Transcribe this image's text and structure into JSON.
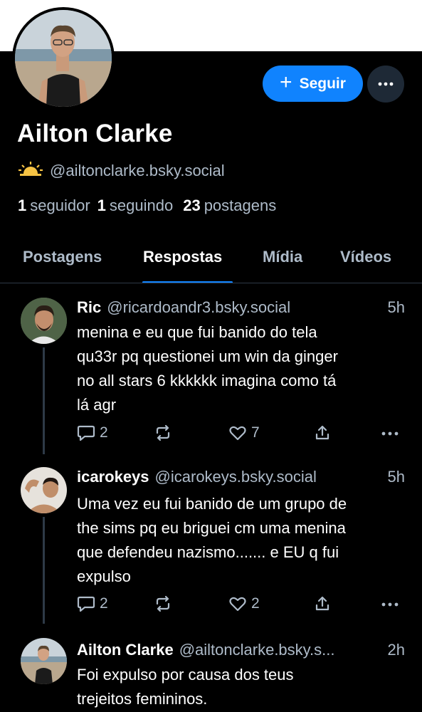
{
  "profile": {
    "display_name": "Ailton Clarke",
    "handle": "@ailtonclarke.bsky.social",
    "emoji": "🌅",
    "follow_label": "Seguir",
    "stats": {
      "followers_count": "1",
      "followers_label": "seguidor",
      "following_count": "1",
      "following_label": "seguindo",
      "posts_count": "23",
      "posts_label": "postagens"
    }
  },
  "tabs": [
    {
      "label": "Postagens",
      "active": false
    },
    {
      "label": "Respostas",
      "active": true
    },
    {
      "label": "Mídia",
      "active": false
    },
    {
      "label": "Vídeos",
      "active": false
    }
  ],
  "posts": [
    {
      "name": "Ric",
      "handle": "@ricardoandr3.bsky.social",
      "time": "5h",
      "lines": [
        "menina e eu que fui banido do tela",
        "qu33r pq questionei um win da ginger",
        "no all stars 6 kkkkkk imagina como tá",
        "lá agr"
      ],
      "replies": "2",
      "likes": "7"
    },
    {
      "name": "icarokeys",
      "handle": "@icarokeys.bsky.social",
      "time": "5h",
      "lines": [
        "Uma vez eu fui banido de um grupo de",
        "the sims pq eu briguei cm uma menina",
        "que defendeu nazismo....... e EU q fui",
        "expulso"
      ],
      "replies": "2",
      "likes": "2"
    },
    {
      "name": "Ailton Clarke",
      "handle": "@ailtonclarke.bsky.s...",
      "time": "2h",
      "lines": [
        "Foi expulso por causa dos teus",
        "trejeitos femininos."
      ]
    }
  ],
  "colors": {
    "accent": "#1083fe",
    "muted": "#aebbc9",
    "background": "#000000",
    "divider": "#2e3a47"
  }
}
